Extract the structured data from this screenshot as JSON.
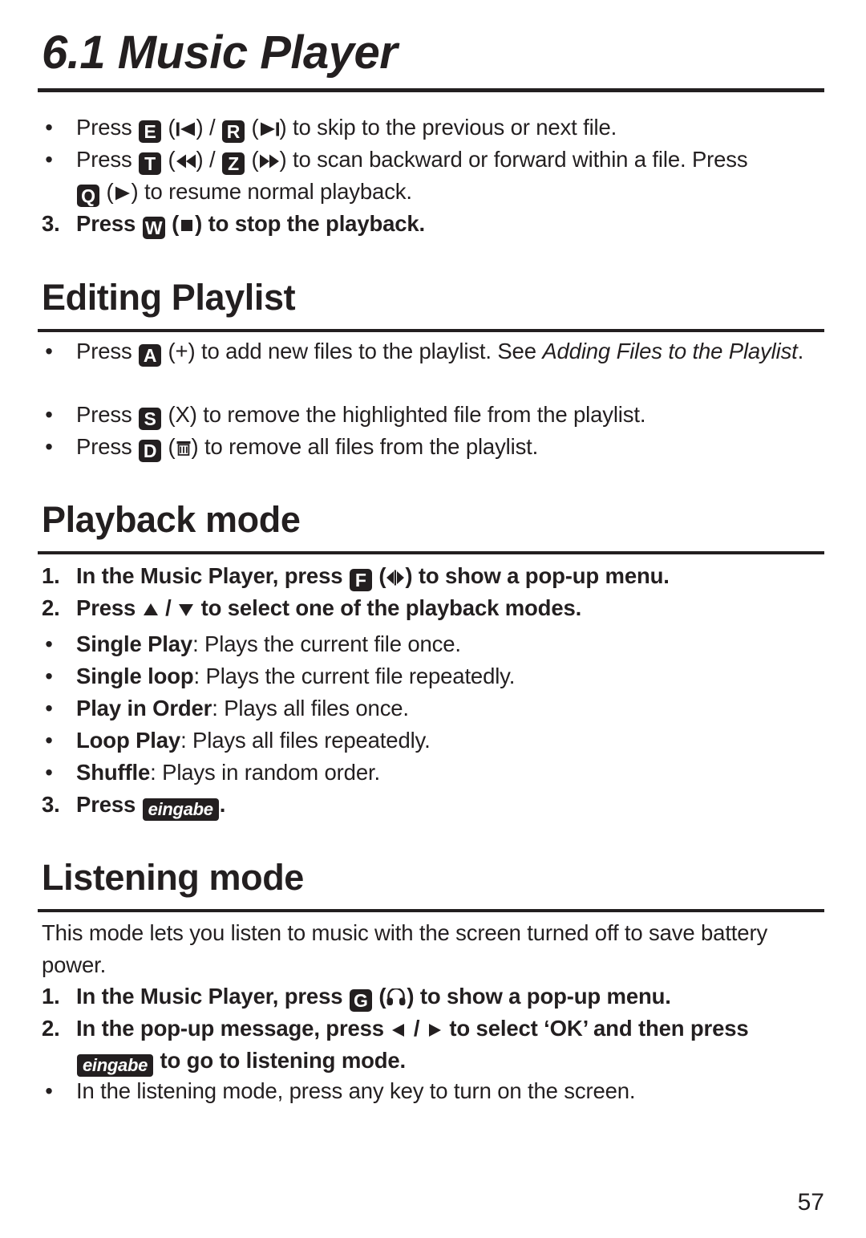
{
  "page": {
    "number": "57",
    "chapter_title": "6.1 Music Player"
  },
  "music_player": {
    "bullets": [
      {
        "pre": "Press ",
        "key1": "E",
        "mid1": " (",
        "icon1": "skip-previous-icon",
        "mid2": ") / ",
        "key2": "R",
        "mid3": " (",
        "icon2": "skip-next-icon",
        "post": ") to skip to the previous or next file."
      },
      {
        "pre": "Press ",
        "key1": "T",
        "mid1": " (",
        "icon1": "rewind-icon",
        "mid2": ") / ",
        "key2": "Z",
        "mid3": " (",
        "icon2": "fast-forward-icon",
        "post": ") to scan backward or forward within a file. Press ",
        "key3": "Q",
        "mid4": " (",
        "icon3": "play-icon",
        "tail": ") to resume normal playback."
      }
    ],
    "step3": {
      "number": "3.",
      "pre": "Press ",
      "key": "W",
      "mid": " (",
      "icon": "stop-icon",
      "post": ") to stop the playback."
    }
  },
  "editing_playlist": {
    "heading": "Editing Playlist",
    "bullets": [
      {
        "pre": "Press ",
        "key": "A",
        "mid": " (+) to add new files to the playlist. See ",
        "italic": "Adding Files to the Playlist",
        "post": "."
      },
      {
        "pre": "Press ",
        "key": "S",
        "mid": " (X) to remove the highlighted file from the playlist."
      },
      {
        "pre": "Press ",
        "key": "D",
        "mid": " (",
        "icon": "trash-icon",
        "post": ") to remove all files from the playlist."
      }
    ]
  },
  "playback_mode": {
    "heading": "Playback mode",
    "steps": [
      {
        "number": "1.",
        "pre": "In the Music Player, press ",
        "key": "F",
        "mid": " (",
        "icon": "playback-mode-icon",
        "post": ") to show a pop-up menu."
      },
      {
        "number": "2.",
        "pre": "Press ",
        "icon_up": "arrow-up-icon",
        "sep": " / ",
        "icon_down": "arrow-down-icon",
        "post": " to select one of the playback modes."
      }
    ],
    "modes": [
      {
        "name": "Single Play",
        "desc": ": Plays the current file once."
      },
      {
        "name": "Single loop",
        "desc": ": Plays the current file repeatedly."
      },
      {
        "name": "Play in Order",
        "desc": ": Plays all files once."
      },
      {
        "name": "Loop Play",
        "desc": ": Plays all files repeatedly."
      },
      {
        "name": "Shuffle",
        "desc": ": Plays in random order."
      }
    ],
    "step3": {
      "number": "3.",
      "pre": "Press ",
      "key": "eingabe",
      "post": "."
    }
  },
  "listening_mode": {
    "heading": "Listening mode",
    "intro": "This mode lets you listen to music with the screen turned off to save battery power.",
    "steps": [
      {
        "number": "1.",
        "pre": "In the Music Player, press ",
        "key": "G",
        "mid": " (",
        "icon": "headphones-icon",
        "post": ") to show a pop-up menu."
      },
      {
        "number": "2.",
        "pre": "In the pop-up message, press ",
        "icon_left": "arrow-left-icon",
        "sep": " / ",
        "icon_right": "arrow-right-icon",
        "mid": " to select ‘OK’ and then press ",
        "key": "eingabe",
        "post": " to go to listening mode."
      }
    ],
    "final_bullet": "In the listening mode, press any key to turn on the screen."
  },
  "symbols": {
    "bullet": "•"
  }
}
